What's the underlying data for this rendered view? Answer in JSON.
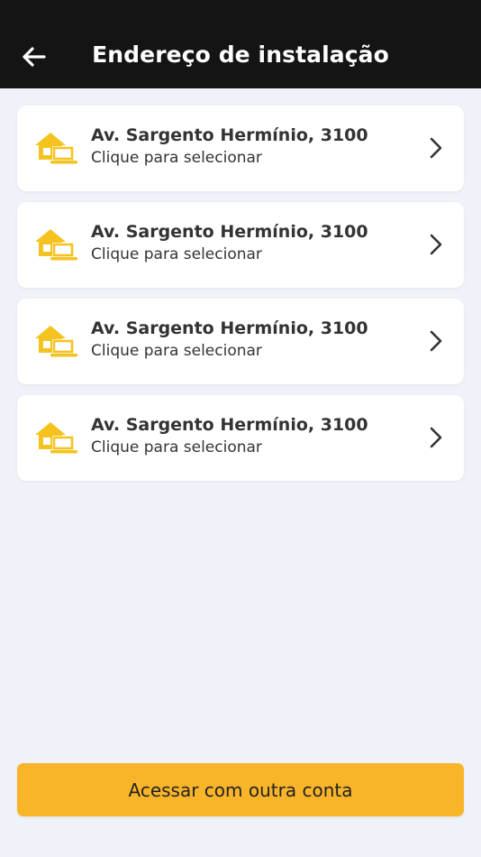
{
  "header": {
    "title": "Endereço de instalação",
    "back_icon": "arrow-left-icon"
  },
  "addresses": [
    {
      "title": "Av. Sargento Hermínio, 3100",
      "subtitle": "Clique para selecionar",
      "icon": "home-laptop-icon"
    },
    {
      "title": "Av. Sargento Hermínio, 3100",
      "subtitle": "Clique para selecionar",
      "icon": "home-laptop-icon"
    },
    {
      "title": "Av. Sargento Hermínio, 3100",
      "subtitle": "Clique para selecionar",
      "icon": "home-laptop-icon"
    },
    {
      "title": "Av. Sargento Hermínio, 3100",
      "subtitle": "Clique para selecionar",
      "icon": "home-laptop-icon"
    }
  ],
  "footer": {
    "button_label": "Acessar com outra conta"
  },
  "colors": {
    "header_bg": "#141414",
    "page_bg": "#eff2f8",
    "accent_yellow": "#f9b52a",
    "icon_yellow": "#f5c320"
  }
}
